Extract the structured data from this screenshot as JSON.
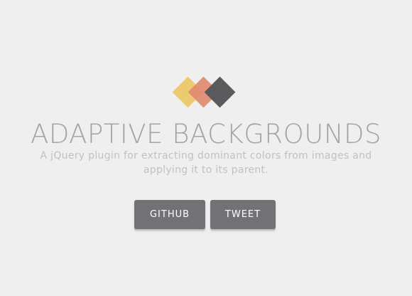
{
  "header": {
    "title": "ADAPTIVE BACKGROUNDS",
    "subtitle": "A jQuery plugin for extracting dominant colors from images and applying it to its parent."
  },
  "logo": {
    "icon": "three-diamonds-logo-icon",
    "colors": [
      "#eccb70",
      "#e08a6f",
      "#5a5a5d"
    ]
  },
  "actions": {
    "github_label": "GITHUB",
    "tweet_label": "TWEET"
  },
  "colors": {
    "background": "#efefef",
    "title": "#a3a3a6",
    "subtitle": "#c1c1c3",
    "button_bg": "#727276",
    "button_text": "#ffffff",
    "button_shadow": "#bdbdbf"
  }
}
